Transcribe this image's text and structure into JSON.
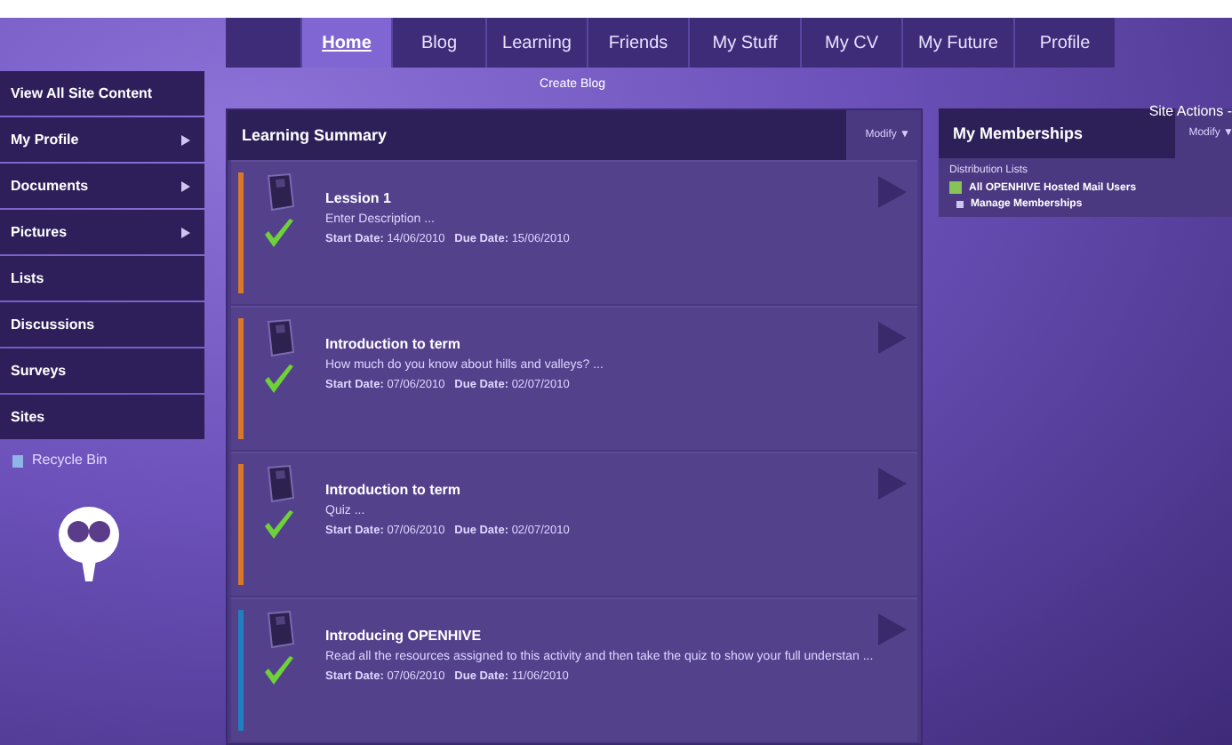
{
  "nav_tabs": [
    {
      "label": "Home",
      "selected": true
    },
    {
      "label": "Blog",
      "selected": false
    },
    {
      "label": "Learning",
      "selected": false
    },
    {
      "label": "Friends",
      "selected": false
    },
    {
      "label": "My Stuff",
      "selected": false
    },
    {
      "label": "My CV",
      "selected": false
    },
    {
      "label": "My Future",
      "selected": false
    },
    {
      "label": "Profile",
      "selected": false
    }
  ],
  "sub_link": "Create Blog",
  "site_actions": "Site Actions -",
  "sidebar": {
    "items": [
      {
        "label": "View All Site Content",
        "has_submenu": false
      },
      {
        "label": "My Profile",
        "has_submenu": true
      },
      {
        "label": "Documents",
        "has_submenu": true
      },
      {
        "label": "Pictures",
        "has_submenu": true
      },
      {
        "label": "Lists",
        "has_submenu": false
      },
      {
        "label": "Discussions",
        "has_submenu": false
      },
      {
        "label": "Surveys",
        "has_submenu": false
      },
      {
        "label": "Sites",
        "has_submenu": false
      }
    ],
    "recycle_bin": "Recycle Bin"
  },
  "learning_summary": {
    "title": "Learning Summary",
    "modify": "Modify ▼",
    "items": [
      {
        "title": "Lession 1",
        "description": "Enter Description ...",
        "start_label": "Start Date:",
        "start": "14/06/2010",
        "due_label": "Due Date:",
        "due": "15/06/2010",
        "color": "#d9782a",
        "completed": true
      },
      {
        "title": "Introduction to term",
        "description": "How much do you know about hills and valleys? ...",
        "start_label": "Start Date:",
        "start": "07/06/2010",
        "due_label": "Due Date:",
        "due": "02/07/2010",
        "color": "#d9782a",
        "completed": true
      },
      {
        "title": "Introduction to term",
        "description": "Quiz ...",
        "start_label": "Start Date:",
        "start": "07/06/2010",
        "due_label": "Due Date:",
        "due": "02/07/2010",
        "color": "#d9782a",
        "completed": true
      },
      {
        "title": "Introducing OPENHIVE",
        "description": "Read all the resources assigned to this activity and then take the quiz to show your full understan ...",
        "start_label": "Start Date:",
        "start": "07/06/2010",
        "due_label": "Due Date:",
        "due": "11/06/2010",
        "color": "#1f7fbf",
        "completed": true
      }
    ]
  },
  "memberships": {
    "title": "My Memberships",
    "modify": "Modify ▼",
    "section": "Distribution Lists",
    "list_item": "All OPENHIVE Hosted Mail Users",
    "manage": "Manage Memberships"
  }
}
